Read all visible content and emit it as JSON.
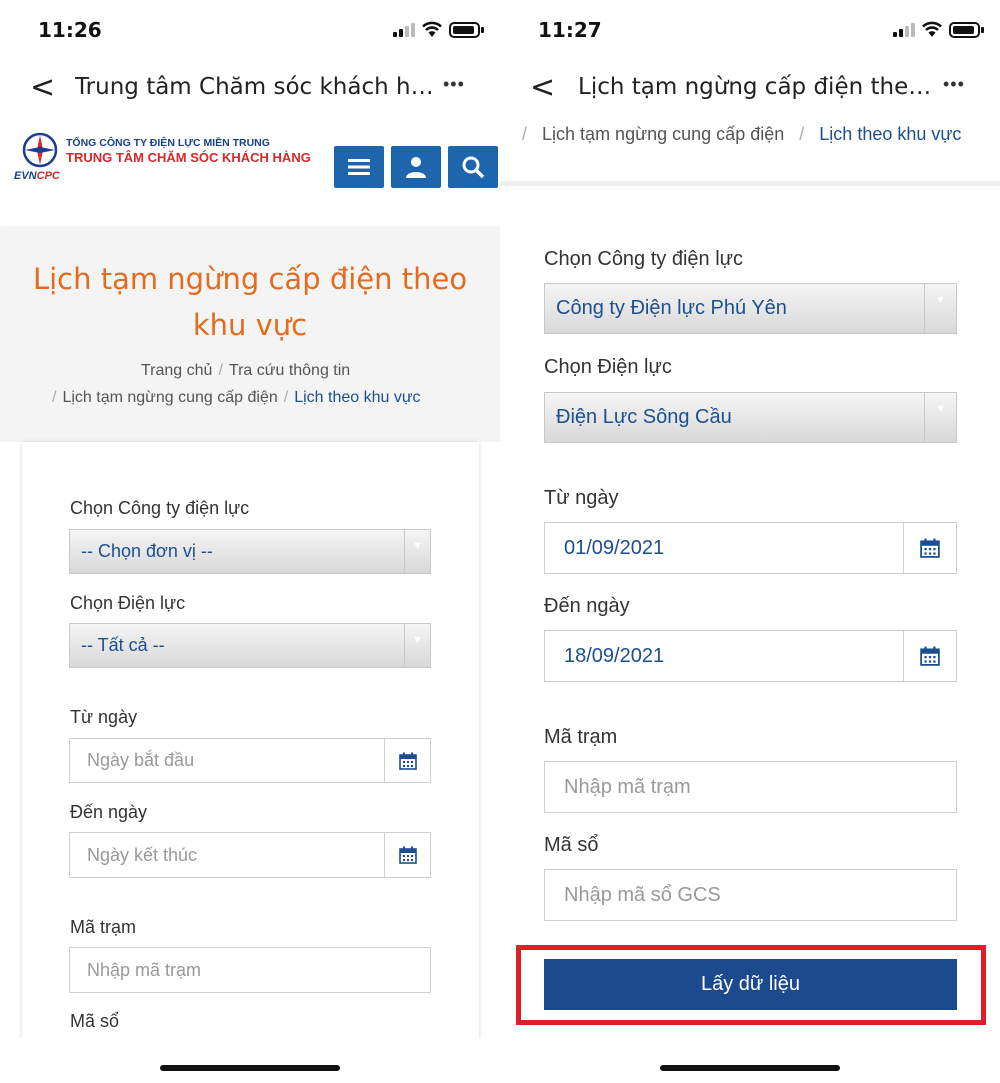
{
  "left": {
    "status": {
      "time": "11:26"
    },
    "nav": {
      "back": "<",
      "title": "Trung tâm Chăm sóc khách hà...",
      "more": "•••"
    },
    "header": {
      "logo_line1": "TỔNG CÔNG TY ĐIỆN LỰC MIỀN TRUNG",
      "logo_line2": "TRUNG TÂM CHĂM SÓC KHÁCH HÀNG",
      "logo_evn": "EVN",
      "logo_cpc": "CPC"
    },
    "hero": {
      "title_line1": "Lịch tạm ngừng cấp điện theo",
      "title_line2": "khu vực",
      "crumb_home": "Trang chủ",
      "crumb_lookup": "Tra cứu thông tin",
      "crumb_outage": "Lịch tạm ngừng cung cấp điện",
      "crumb_current": "Lịch theo khu vực",
      "sep": "/"
    },
    "form": {
      "company_label": "Chọn Công ty điện lực",
      "company_value": "-- Chọn đơn vị --",
      "branch_label": "Chọn Điện lực",
      "branch_value": "-- Tất cả --",
      "from_label": "Từ ngày",
      "from_placeholder": "Ngày bắt đầu",
      "to_label": "Đến ngày",
      "to_placeholder": "Ngày kết thúc",
      "station_label": "Mã trạm",
      "station_placeholder": "Nhập mã trạm",
      "book_label": "Mã sổ"
    }
  },
  "right": {
    "status": {
      "time": "11:27"
    },
    "nav": {
      "back": "<",
      "title": "Lịch tạm ngừng cấp điện theo...",
      "more": "•••"
    },
    "breadcrumb": {
      "sep": "/",
      "outage": "Lịch tạm ngừng cung cấp điện",
      "current": "Lịch theo khu vực"
    },
    "form": {
      "company_label": "Chọn Công ty điện lực",
      "company_value": "Công ty Điện lực Phú Yên",
      "branch_label": "Chọn Điện lực",
      "branch_value": "Điện Lực Sông Cầu",
      "from_label": "Từ ngày",
      "from_value": "01/09/2021",
      "to_label": "Đến ngày",
      "to_value": "18/09/2021",
      "station_label": "Mã trạm",
      "station_placeholder": "Nhập mã trạm",
      "book_label": "Mã sổ",
      "book_placeholder": "Nhập mã sổ GCS",
      "submit_label": "Lấy dữ liệu"
    }
  },
  "colors": {
    "brand_blue": "#1d65ad",
    "title_orange": "#e46c1f",
    "button_blue": "#1c4a8e",
    "highlight_red": "#e01e2a"
  }
}
